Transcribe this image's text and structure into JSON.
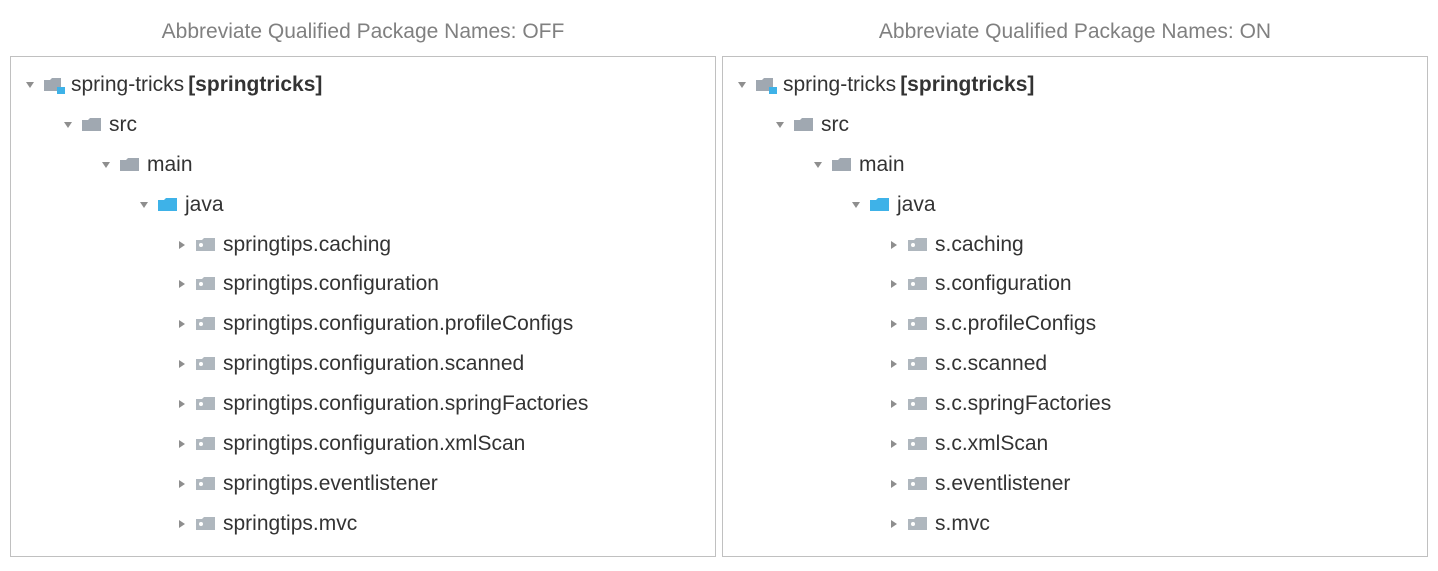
{
  "panels": [
    {
      "title": "Abbreviate Qualified Package Names: OFF",
      "root": {
        "label": "spring-tricks",
        "boldSuffix": "[springtricks]",
        "icon": "module",
        "expanded": true,
        "children": [
          {
            "label": "src",
            "icon": "folder",
            "expanded": true,
            "children": [
              {
                "label": "main",
                "icon": "folder",
                "expanded": true,
                "children": [
                  {
                    "label": "java",
                    "icon": "source-folder",
                    "expanded": true,
                    "children": [
                      {
                        "label": "springtips.caching",
                        "icon": "package",
                        "expanded": false
                      },
                      {
                        "label": "springtips.configuration",
                        "icon": "package",
                        "expanded": false
                      },
                      {
                        "label": "springtips.configuration.profileConfigs",
                        "icon": "package",
                        "expanded": false
                      },
                      {
                        "label": "springtips.configuration.scanned",
                        "icon": "package",
                        "expanded": false
                      },
                      {
                        "label": "springtips.configuration.springFactories",
                        "icon": "package",
                        "expanded": false
                      },
                      {
                        "label": "springtips.configuration.xmlScan",
                        "icon": "package",
                        "expanded": false
                      },
                      {
                        "label": "springtips.eventlistener",
                        "icon": "package",
                        "expanded": false
                      },
                      {
                        "label": "springtips.mvc",
                        "icon": "package",
                        "expanded": false
                      }
                    ]
                  }
                ]
              }
            ]
          }
        ]
      }
    },
    {
      "title": "Abbreviate Qualified Package Names: ON",
      "root": {
        "label": "spring-tricks",
        "boldSuffix": "[springtricks]",
        "icon": "module",
        "expanded": true,
        "children": [
          {
            "label": "src",
            "icon": "folder",
            "expanded": true,
            "children": [
              {
                "label": "main",
                "icon": "folder",
                "expanded": true,
                "children": [
                  {
                    "label": "java",
                    "icon": "source-folder",
                    "expanded": true,
                    "children": [
                      {
                        "label": "s.caching",
                        "icon": "package",
                        "expanded": false
                      },
                      {
                        "label": "s.configuration",
                        "icon": "package",
                        "expanded": false
                      },
                      {
                        "label": "s.c.profileConfigs",
                        "icon": "package",
                        "expanded": false
                      },
                      {
                        "label": "s.c.scanned",
                        "icon": "package",
                        "expanded": false
                      },
                      {
                        "label": "s.c.springFactories",
                        "icon": "package",
                        "expanded": false
                      },
                      {
                        "label": "s.c.xmlScan",
                        "icon": "package",
                        "expanded": false
                      },
                      {
                        "label": "s.eventlistener",
                        "icon": "package",
                        "expanded": false
                      },
                      {
                        "label": "s.mvc",
                        "icon": "package",
                        "expanded": false
                      }
                    ]
                  }
                ]
              }
            ]
          }
        ]
      }
    }
  ],
  "icons": {
    "colors": {
      "folder_gray": "#a0a8b1",
      "source_folder": "#3eb2e8",
      "module_overlay": "#3eb2e8",
      "package_gray": "#afb7be",
      "package_dot": "#ffffff"
    }
  }
}
